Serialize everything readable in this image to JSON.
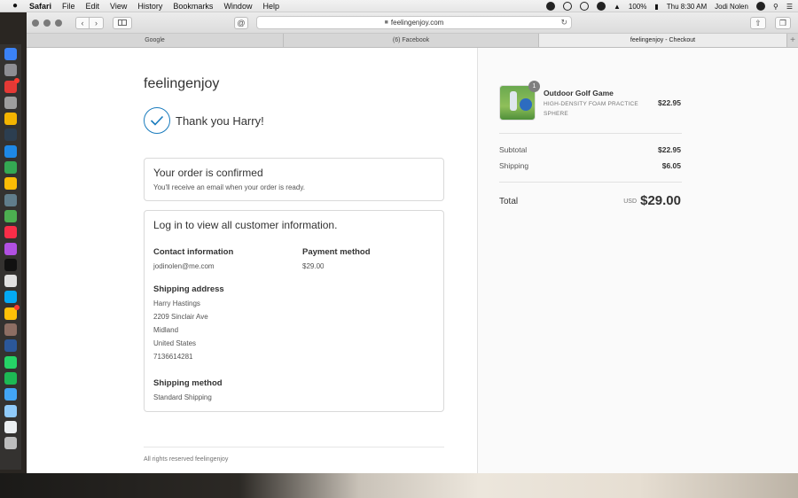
{
  "menubar": {
    "app": "Safari",
    "items": [
      "File",
      "Edit",
      "View",
      "History",
      "Bookmarks",
      "Window",
      "Help"
    ],
    "battery": "100%",
    "clock": "Thu 8:30 AM",
    "user": "Jodi Nolen"
  },
  "browser": {
    "url": "feelingenjoy.com",
    "tabs": [
      "Google",
      "(6) Facebook",
      "feelingenjoy - Checkout"
    ]
  },
  "order": {
    "shop_name": "feelingenjoy",
    "thanks": "Thank you Harry!",
    "confirmed_title": "Your order is confirmed",
    "confirmed_sub": "You'll receive an email when your order is ready.",
    "login_title": "Log in to view all customer information.",
    "contact_label": "Contact information",
    "contact_value": "jodinolen@me.com",
    "payment_label": "Payment method",
    "payment_value": "$29.00",
    "shipping_address_label": "Shipping address",
    "address_lines": [
      "Harry Hastings",
      "2209 Sinclair Ave",
      "Midland",
      "United States",
      "7136614281"
    ],
    "shipping_method_label": "Shipping method",
    "shipping_method_value": "Standard Shipping",
    "footer": "All rights reserved feelingenjoy"
  },
  "summary": {
    "product_name": "Outdoor Golf Game",
    "product_variant": "HIGH-DENSITY FOAM PRACTICE SPHERE",
    "product_price": "$22.95",
    "quantity": "1",
    "subtotal_label": "Subtotal",
    "subtotal_value": "$22.95",
    "shipping_label": "Shipping",
    "shipping_value": "$6.05",
    "total_label": "Total",
    "currency": "USD",
    "total_value": "$29.00"
  },
  "colors": {
    "accent": "#197bbd",
    "dock_apps": [
      "#3b82f6",
      "#8e8e93",
      "#e53935",
      "#9e9e9e",
      "#f4b400",
      "#2c3e50",
      "#1e88e5",
      "#34a853",
      "#fbbc05",
      "#607d8b",
      "#4caf50",
      "#fa2d48",
      "#b150e2",
      "#111111",
      "#e0e0e0",
      "#03a9f4",
      "#ffc107",
      "#8d6e63",
      "#2b579a",
      "#25d366",
      "#1db954",
      "#42a5f5",
      "#90caf9",
      "#eceff1",
      "#bdbdbd"
    ]
  }
}
